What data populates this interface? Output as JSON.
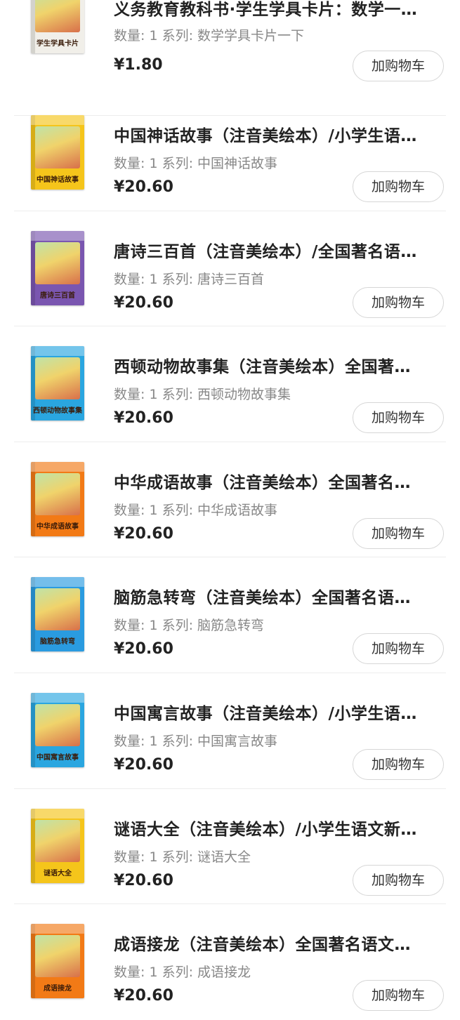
{
  "items": [
    {
      "title": "义务教育教科书·学生学具卡片：数学一…",
      "cover_title": "学生学具卡片",
      "quantity_label": "数量: 1",
      "series_label": "系列: 数学学具卡片一下",
      "price": "¥1.80",
      "cart_label": "加购物车",
      "cover_color": "#f1efe9"
    },
    {
      "title": "中国神话故事（注音美绘本）/小学生语…",
      "cover_title": "中国神话故事",
      "quantity_label": "数量: 1",
      "series_label": "系列: 中国神话故事",
      "price": "¥20.60",
      "cart_label": "加购物车",
      "cover_color": "#f5c51b"
    },
    {
      "title": "唐诗三百首（注音美绘本）/全国著名语…",
      "cover_title": "唐诗三百首",
      "quantity_label": "数量: 1",
      "series_label": "系列: 唐诗三百首",
      "price": "¥20.60",
      "cart_label": "加购物车",
      "cover_color": "#7a56b0"
    },
    {
      "title": "西顿动物故事集（注音美绘本）全国著…",
      "cover_title": "西顿动物故事集",
      "quantity_label": "数量: 1",
      "series_label": "系列: 西顿动物故事集",
      "price": "¥20.60",
      "cart_label": "加购物车",
      "cover_color": "#2aa6e0"
    },
    {
      "title": "中华成语故事（注音美绘本）全国著名…",
      "cover_title": "中华成语故事",
      "quantity_label": "数量: 1",
      "series_label": "系列: 中华成语故事",
      "price": "¥20.60",
      "cart_label": "加购物车",
      "cover_color": "#f27a16"
    },
    {
      "title": "脑筋急转弯（注音美绘本）全国著名语…",
      "cover_title": "脑筋急转弯",
      "quantity_label": "数量: 1",
      "series_label": "系列: 脑筋急转弯",
      "price": "¥20.60",
      "cart_label": "加购物车",
      "cover_color": "#2a9be0"
    },
    {
      "title": "中国寓言故事（注音美绘本）/小学生语…",
      "cover_title": "中国寓言故事",
      "quantity_label": "数量: 1",
      "series_label": "系列: 中国寓言故事",
      "price": "¥20.60",
      "cart_label": "加购物车",
      "cover_color": "#2aa6e0"
    },
    {
      "title": "谜语大全（注音美绘本）/小学生语文新…",
      "cover_title": "谜语大全",
      "quantity_label": "数量: 1",
      "series_label": "系列: 谜语大全",
      "price": "¥20.60",
      "cart_label": "加购物车",
      "cover_color": "#f5c51b"
    },
    {
      "title": "成语接龙（注音美绘本）全国著名语文…",
      "cover_title": "成语接龙",
      "quantity_label": "数量: 1",
      "series_label": "系列: 成语接龙",
      "price": "¥20.60",
      "cart_label": "加购物车",
      "cover_color": "#f27a16"
    }
  ]
}
